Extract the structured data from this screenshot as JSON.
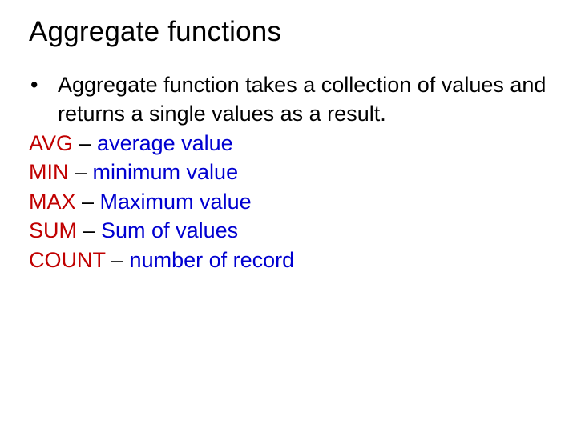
{
  "title": "Aggregate functions",
  "bullet": {
    "dot": "•",
    "text": "Aggregate function takes a collection of values and returns a single values as a result."
  },
  "functions": [
    {
      "keyword": "AVG",
      "dash": " – ",
      "desc": "average value"
    },
    {
      "keyword": "MIN",
      "dash": " – ",
      "desc": "minimum value"
    },
    {
      "keyword": "MAX",
      "dash": " – ",
      "desc": "Maximum value"
    },
    {
      "keyword": "SUM",
      "dash": " – ",
      "desc": "Sum of values"
    },
    {
      "keyword": "COUNT",
      "dash": " – ",
      "desc": "number of record"
    }
  ]
}
